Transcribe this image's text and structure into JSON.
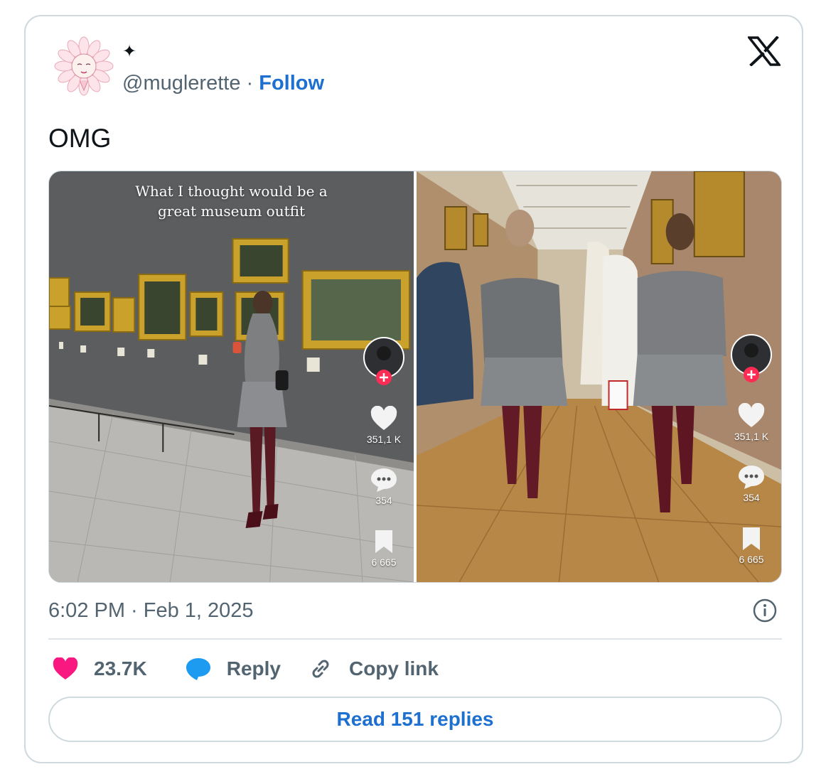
{
  "author": {
    "display_name": "✦",
    "handle": "@muglerette",
    "separator": "·",
    "follow_label": "Follow"
  },
  "tweet": {
    "text": "OMG",
    "timestamp": "6:02 PM · Feb 1, 2025"
  },
  "media": {
    "left": {
      "caption_line1": "What I thought would be a",
      "caption_line2": "great museum outfit",
      "likes": "351,1 K",
      "comments": "354",
      "saves": "6 665"
    },
    "right": {
      "likes": "351,1 K",
      "comments": "354",
      "saves": "6 665"
    }
  },
  "actions": {
    "likes_count": "23.7K",
    "reply_label": "Reply",
    "copy_link_label": "Copy link"
  },
  "read_replies_label": "Read 151 replies",
  "colors": {
    "accent_blue": "#1d6fd0",
    "heart_pink": "#f91880",
    "reply_blue": "#1d9bf0",
    "muted_text": "#536471",
    "border": "#cfd9de"
  }
}
